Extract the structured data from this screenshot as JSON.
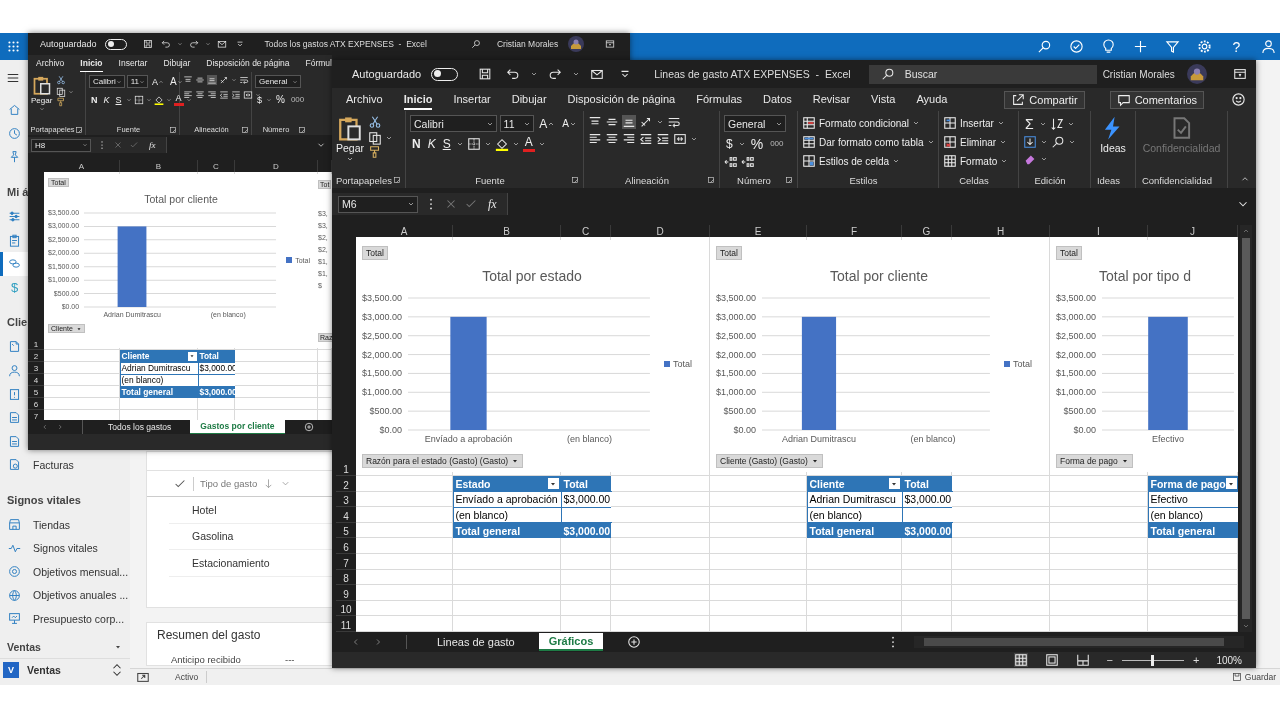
{
  "top_bar": {
    "help": "?"
  },
  "sidebar": {
    "sections": [
      {
        "items": [
          {
            "selected": false
          },
          {
            "selected": false
          },
          {
            "selected": false
          }
        ]
      },
      {
        "title": "Mi á",
        "items": [
          {
            "selected": false
          },
          {
            "selected": false
          },
          {
            "selected": true
          },
          {
            "glyph": "$",
            "selected": false
          }
        ]
      },
      {
        "title": "Clie",
        "items": [
          {
            "selected": false
          },
          {
            "selected": false
          },
          {
            "selected": false
          },
          {
            "selected": false
          },
          {
            "selected": false
          },
          {
            "label": "Facturas",
            "selected": false
          }
        ]
      },
      {
        "title": "Signos vitales",
        "items": [
          {
            "label": "Tiendas",
            "selected": false
          },
          {
            "label": "Signos vitales",
            "selected": false
          },
          {
            "label": "Objetivos mensual...",
            "selected": false
          },
          {
            "label": "Objetivos anuales ...",
            "selected": false
          },
          {
            "label": "Presupuesto corp...",
            "selected": false
          }
        ]
      }
    ],
    "area_header": "Ventas",
    "area": {
      "badge": "V",
      "label": "Ventas"
    }
  },
  "main": {
    "list": {
      "column": "Tipo de gasto",
      "rows": [
        "Hotel",
        "Gasolina",
        "Estacionamiento"
      ]
    },
    "summary": {
      "title": "Resumen del gasto",
      "fields": [
        {
          "label": "Anticipo recibido",
          "value": "---"
        }
      ]
    }
  },
  "status_bar": {
    "state": "Activo",
    "save": "Guardar"
  },
  "back_window": {
    "autosave": {
      "label": "Autoguardado",
      "on": false
    },
    "title": "Todos los gastos ATX EXPENSES  -  Excel",
    "user": "Cristian Morales",
    "tabs": [
      {
        "label": "Archivo",
        "selected": false
      },
      {
        "label": "Inicio",
        "selected": true
      },
      {
        "label": "Insertar",
        "selected": false
      },
      {
        "label": "Dibujar",
        "selected": false
      },
      {
        "label": "Disposición de página",
        "selected": false
      },
      {
        "label": "Fórmul",
        "selected": false
      }
    ],
    "ribbon": {
      "clipboard": {
        "paste": "Pegar",
        "label": "Portapapeles"
      },
      "font": {
        "name": "Calibri",
        "size": "11",
        "grow": "A",
        "shrink": "A",
        "bold": "N",
        "italic": "K",
        "underline": "S",
        "font_color": "A",
        "label": "Fuente"
      },
      "alignment": {
        "label": "Alineación"
      },
      "number": {
        "format": "General",
        "currency": "$",
        "percent": "%",
        "thousands": "000",
        "label": "Número"
      }
    },
    "name_box": "H8",
    "fx": "fx",
    "columns": [
      "A",
      "B",
      "C",
      "D"
    ],
    "rows": [
      {
        "header": "1"
      },
      {
        "header": "2",
        "cells": [
          null,
          {
            "text": "Cliente",
            "kind": "head",
            "filter": true
          },
          {
            "text": "Total",
            "kind": "head",
            "filter": false
          },
          null
        ]
      },
      {
        "header": "3",
        "cells": [
          null,
          {
            "text": "Adrian Dumitrascu",
            "kind": "body"
          },
          {
            "text": "$3,000.00",
            "kind": "body"
          },
          null
        ]
      },
      {
        "header": "4",
        "cells": [
          null,
          {
            "text": "(en blanco)",
            "kind": "body"
          },
          {
            "kind": "body"
          },
          null
        ]
      },
      {
        "header": "5",
        "cells": [
          null,
          {
            "text": "Total general",
            "kind": "total"
          },
          {
            "text": "$3,000.00",
            "kind": "total"
          },
          null
        ]
      },
      {
        "header": "6"
      },
      {
        "header": "7"
      }
    ],
    "charts": [
      {
        "field": "Total",
        "filter": "Cliente",
        "chart_data": {
          "type": "bar",
          "grid": true,
          "title": "Total por cliente",
          "categories": [
            "Adrian Dumitrascu",
            "(en blanco)"
          ],
          "series": [
            {
              "name": "Total",
              "color": "#4472c4",
              "values": [
                3000,
                null
              ]
            }
          ],
          "ylim": [
            0,
            3500
          ],
          "yticks": [
            {
              "value": 0,
              "label": "$0.00"
            },
            {
              "value": 500,
              "label": "$500.00"
            },
            {
              "value": 1000,
              "label": "$1,000.00"
            },
            {
              "value": 1500,
              "label": "$1,500.00"
            },
            {
              "value": 2000,
              "label": "$2,000.00"
            },
            {
              "value": 2500,
              "label": "$2,500.00"
            },
            {
              "value": 3000,
              "label": "$3,000.00"
            },
            {
              "value": 3500,
              "label": "$3,500.00"
            }
          ]
        }
      }
    ],
    "chart_fragment": {
      "field": "Tot",
      "filter": "Raz",
      "ticks": [
        "$3,",
        "$3,",
        "$2,",
        "$2,",
        "$1,",
        "$1,",
        "$"
      ]
    },
    "sheets": [
      {
        "label": "Todos los gastos",
        "selected": false
      },
      {
        "label": "Gastos por cliente",
        "selected": true
      }
    ]
  },
  "front_window": {
    "autosave": {
      "label": "Autoguardado",
      "on": false
    },
    "title": "Lineas de gasto ATX EXPENSES  -  Excel",
    "search": {
      "placeholder": "Buscar"
    },
    "user": "Cristian Morales",
    "tabs": [
      {
        "label": "Archivo",
        "selected": false
      },
      {
        "label": "Inicio",
        "selected": true
      },
      {
        "label": "Insertar",
        "selected": false
      },
      {
        "label": "Dibujar",
        "selected": false
      },
      {
        "label": "Disposición de página",
        "selected": false
      },
      {
        "label": "Fórmulas",
        "selected": false
      },
      {
        "label": "Datos",
        "selected": false
      },
      {
        "label": "Revisar",
        "selected": false
      },
      {
        "label": "Vista",
        "selected": false
      },
      {
        "label": "Ayuda",
        "selected": false
      }
    ],
    "share": "Compartir",
    "comments": "Comentarios",
    "ribbon": {
      "clipboard": {
        "paste": "Pegar",
        "label": "Portapapeles"
      },
      "font": {
        "name": "Calibri",
        "size": "11",
        "grow": "A",
        "shrink": "A",
        "bold": "N",
        "italic": "K",
        "underline": "S",
        "font_color": "A",
        "label": "Fuente"
      },
      "alignment": {
        "label": "Alineación"
      },
      "number": {
        "format": "General",
        "currency": "$",
        "percent": "%",
        "thousands": "000",
        "label": "Número"
      },
      "styles": {
        "items": [
          "Formato condicional",
          "Dar formato como tabla",
          "Estilos de celda"
        ],
        "label": "Estilos"
      },
      "cells": {
        "items": [
          "Insertar",
          "Eliminar",
          "Formato"
        ],
        "label": "Celdas"
      },
      "editing": {
        "sum": "Σ",
        "label": "Edición"
      },
      "ideas": {
        "button": "Ideas",
        "label": "Ideas"
      },
      "sensitivity": {
        "button": "Confidencialidad",
        "label": "Confidencialidad",
        "disabled": true
      }
    },
    "name_box": "M6",
    "fx": "fx",
    "columns": [
      "A",
      "B",
      "C",
      "D",
      "E",
      "F",
      "G",
      "H",
      "I",
      "J"
    ],
    "rows": [
      {
        "header": "1"
      },
      {
        "header": "2",
        "cells": [
          null,
          {
            "text": "Estado",
            "kind": "head",
            "filter": true
          },
          {
            "text": "Total",
            "kind": "head",
            "filter": false
          },
          null,
          null,
          {
            "text": "Cliente",
            "kind": "head",
            "filter": true
          },
          {
            "text": "Total",
            "kind": "head",
            "filter": false
          },
          null,
          null,
          {
            "text": "Forma de pago",
            "kind": "head",
            "filter": true
          }
        ]
      },
      {
        "header": "3",
        "cells": [
          null,
          {
            "text": "Envíado a aprobación",
            "kind": "body"
          },
          {
            "text": "$3,000.00",
            "kind": "body"
          },
          null,
          null,
          {
            "text": "Adrian Dumitrascu",
            "kind": "body"
          },
          {
            "text": "$3,000.00",
            "kind": "body"
          },
          null,
          null,
          {
            "text": "Efectivo",
            "kind": "body"
          }
        ]
      },
      {
        "header": "4",
        "cells": [
          null,
          {
            "text": "(en blanco)",
            "kind": "body"
          },
          {
            "kind": "body"
          },
          null,
          null,
          {
            "text": "(en blanco)",
            "kind": "body"
          },
          {
            "kind": "body"
          },
          null,
          null,
          {
            "text": "(en blanco)",
            "kind": "body"
          }
        ]
      },
      {
        "header": "5",
        "cells": [
          null,
          {
            "text": "Total general",
            "kind": "total"
          },
          {
            "text": "$3,000.00",
            "kind": "total"
          },
          null,
          null,
          {
            "text": "Total general",
            "kind": "total"
          },
          {
            "text": "$3,000.00",
            "kind": "total"
          },
          null,
          null,
          {
            "text": "Total general",
            "kind": "total"
          }
        ]
      },
      {
        "header": "6"
      },
      {
        "header": "7"
      },
      {
        "header": "8"
      },
      {
        "header": "9"
      },
      {
        "header": "10"
      },
      {
        "header": "11"
      }
    ],
    "charts": [
      {
        "field": "Total",
        "filter": "Razón para el estado (Gasto) (Gasto)",
        "chart_data": {
          "type": "bar",
          "grid": true,
          "title": "Total por estado",
          "categories": [
            "Envíado a aprobación",
            "(en blanco)"
          ],
          "series": [
            {
              "name": "Total",
              "color": "#4472c4",
              "values": [
                3000,
                null
              ]
            }
          ],
          "ylim": [
            0,
            3500
          ],
          "yticks": [
            {
              "value": 0,
              "label": "$0.00"
            },
            {
              "value": 500,
              "label": "$500.00"
            },
            {
              "value": 1000,
              "label": "$1,000.00"
            },
            {
              "value": 1500,
              "label": "$1,500.00"
            },
            {
              "value": 2000,
              "label": "$2,000.00"
            },
            {
              "value": 2500,
              "label": "$2,500.00"
            },
            {
              "value": 3000,
              "label": "$3,000.00"
            },
            {
              "value": 3500,
              "label": "$3,500.00"
            }
          ]
        }
      },
      {
        "field": "Total",
        "filter": "Cliente (Gasto) (Gasto)",
        "chart_data": {
          "type": "bar",
          "grid": true,
          "title": "Total por cliente",
          "categories": [
            "Adrian Dumitrascu",
            "(en blanco)"
          ],
          "series": [
            {
              "name": "Total",
              "color": "#4472c4",
              "values": [
                3000,
                null
              ]
            }
          ],
          "ylim": [
            0,
            3500
          ],
          "yticks": [
            {
              "value": 0,
              "label": "$0.00"
            },
            {
              "value": 500,
              "label": "$500.00"
            },
            {
              "value": 1000,
              "label": "$1,000.00"
            },
            {
              "value": 1500,
              "label": "$1,500.00"
            },
            {
              "value": 2000,
              "label": "$2,000.00"
            },
            {
              "value": 2500,
              "label": "$2,500.00"
            },
            {
              "value": 3000,
              "label": "$3,000.00"
            },
            {
              "value": 3500,
              "label": "$3,500.00"
            }
          ]
        }
      },
      {
        "field": "Total",
        "filter": "Forma de pago",
        "chart_data": {
          "type": "bar",
          "grid": true,
          "title": "Total por tipo d",
          "categories": [
            "Efectivo"
          ],
          "series": [
            {
              "color": "#4472c4",
              "values": [
                3000
              ]
            }
          ],
          "ylim": [
            0,
            3500
          ],
          "yticks": [
            {
              "value": 0,
              "label": "$0.00"
            },
            {
              "value": 500,
              "label": "$500.00"
            },
            {
              "value": 1000,
              "label": "$1,000.00"
            },
            {
              "value": 1500,
              "label": "$1,500.00"
            },
            {
              "value": 2000,
              "label": "$2,000.00"
            },
            {
              "value": 2500,
              "label": "$2,500.00"
            },
            {
              "value": 3000,
              "label": "$3,000.00"
            },
            {
              "value": 3500,
              "label": "$3,500.00"
            }
          ]
        }
      }
    ],
    "sheets": [
      {
        "label": "Lineas de gasto",
        "selected": false
      },
      {
        "label": "Gráficos",
        "selected": true
      }
    ],
    "zoom": {
      "minus": "−",
      "level": 0.5,
      "plus": "+",
      "reading": "100%"
    }
  }
}
